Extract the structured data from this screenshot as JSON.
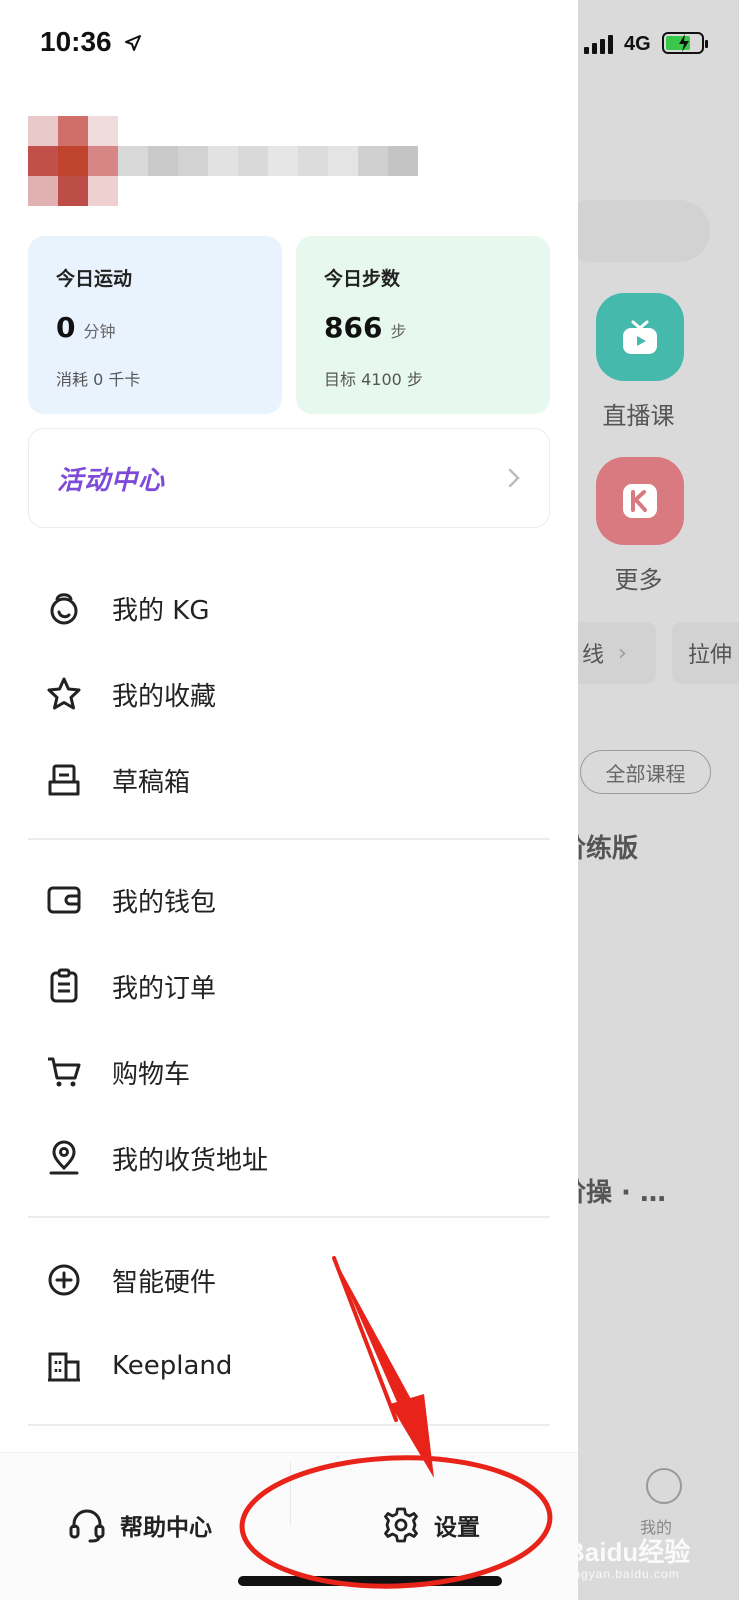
{
  "status_bar": {
    "time": "10:36",
    "network": "4G"
  },
  "stats": {
    "sport": {
      "title": "今日运动",
      "value": "0",
      "unit": "分钟",
      "sub": "消耗 0 千卡"
    },
    "steps": {
      "title": "今日步数",
      "value": "866",
      "unit": "步",
      "sub": "目标 4100 步"
    }
  },
  "activity_center": {
    "label": "活动中心"
  },
  "menu": {
    "group1": [
      {
        "label": "我的 KG",
        "icon": "kettlebell-icon"
      },
      {
        "label": "我的收藏",
        "icon": "star-icon"
      },
      {
        "label": "草稿箱",
        "icon": "draft-box-icon"
      }
    ],
    "group2": [
      {
        "label": "我的钱包",
        "icon": "wallet-icon"
      },
      {
        "label": "我的订单",
        "icon": "clipboard-icon"
      },
      {
        "label": "购物车",
        "icon": "cart-icon"
      },
      {
        "label": "我的收货地址",
        "icon": "location-pin-icon"
      }
    ],
    "group3": [
      {
        "label": "智能硬件",
        "icon": "plus-circle-icon"
      },
      {
        "label": "Keepland",
        "icon": "building-icon"
      }
    ]
  },
  "bottom_bar": {
    "help_label": "帮助中心",
    "settings_label": "设置"
  },
  "background_app": {
    "live_label": "直播课",
    "more_label": "更多",
    "chip1": "线",
    "chip2": "拉伸",
    "all_courses": "全部课程",
    "heading1": "阶练版",
    "heading2": "阶操 · …",
    "tab_mine": "我的"
  },
  "watermark": {
    "brand": "Baidu经验",
    "url": "jingyan.baidu.com"
  },
  "colors": {
    "accent_purple": "#7e4bd8",
    "annotation_red": "#e8231a",
    "sport_card_bg": "#e9f3fe",
    "steps_card_bg": "#e7f8ef"
  }
}
